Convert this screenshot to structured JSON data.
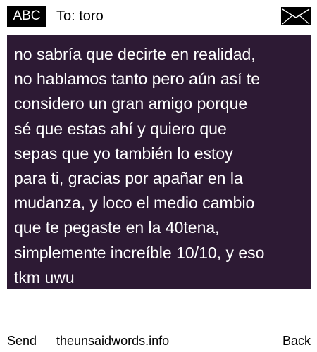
{
  "header": {
    "mode_label": "ABC",
    "recipient": "To: toro",
    "envelope_icon": "envelope-icon"
  },
  "message": {
    "text": "no sabría que decirte en realidad,\nno hablamos tanto pero aún así te\nconsidero un gran amigo porque\nsé que estas ahí y quiero que\nsepas que yo también lo estoy\npara ti, gracias por apañar en la\nmudanza, y loco el medio cambio\nque te pegaste en la 40tena,\nsimplemente increíble 10/10, y eso\ntkm uwu"
  },
  "footer": {
    "send_label": "Send",
    "site_label": "theunsaidwords.info",
    "back_label": "Back"
  },
  "colors": {
    "message_background": "#2d1a34",
    "message_text": "#ffffff",
    "badge_background": "#000000"
  }
}
